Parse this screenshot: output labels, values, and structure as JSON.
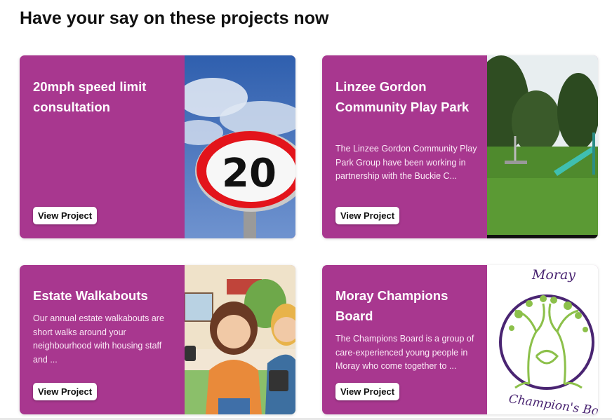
{
  "page": {
    "title": "Have your say on these projects now"
  },
  "cards": [
    {
      "title": "20mph speed limit consultation",
      "description": "",
      "button": "View Project",
      "image": {
        "icon": "speed-limit-sign-image",
        "sign_text": "20"
      }
    },
    {
      "title": "Linzee Gordon Community Play Park",
      "description": "The Linzee Gordon Community Play Park Group have been working in partnership with the Buckie C...",
      "button": "View Project",
      "image": {
        "icon": "play-park-image"
      }
    },
    {
      "title": "Estate Walkabouts",
      "description": "Our annual estate walkabouts are short walks around your neighbourhood with housing staff and ...",
      "button": "View Project",
      "image": {
        "icon": "walkabout-illustration-image"
      }
    },
    {
      "title": "Moray Champions Board",
      "description": "The Champions Board is a group of care-experienced young people in Moray who come together to ...",
      "button": "View Project",
      "image": {
        "icon": "champions-board-logo-image",
        "logo_top": "Moray",
        "logo_bottom": "Champion's Bo"
      }
    }
  ],
  "colors": {
    "card_bg": "#a8378f",
    "button_bg": "#ffffff",
    "title": "#111111"
  }
}
